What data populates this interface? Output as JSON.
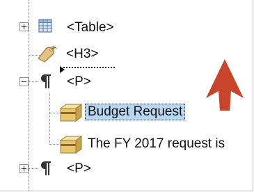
{
  "tree": {
    "nodes": [
      {
        "label": "<Table>",
        "icon": "table-icon",
        "expander": "plus"
      },
      {
        "label": "<H3>",
        "icon": "tag-icon",
        "expander": null
      },
      {
        "label": "<P>",
        "icon": "paragraph-icon",
        "expander": "minus"
      },
      {
        "label": "Budget Request",
        "icon": "container-icon",
        "expander": null,
        "selected": true
      },
      {
        "label": "The FY 2017 request is",
        "icon": "container-icon",
        "expander": null
      },
      {
        "label": "<P>",
        "icon": "paragraph-icon",
        "expander": "plus"
      }
    ]
  },
  "annotation": {
    "icon": "up-arrow-icon",
    "color": "#c8442a"
  }
}
